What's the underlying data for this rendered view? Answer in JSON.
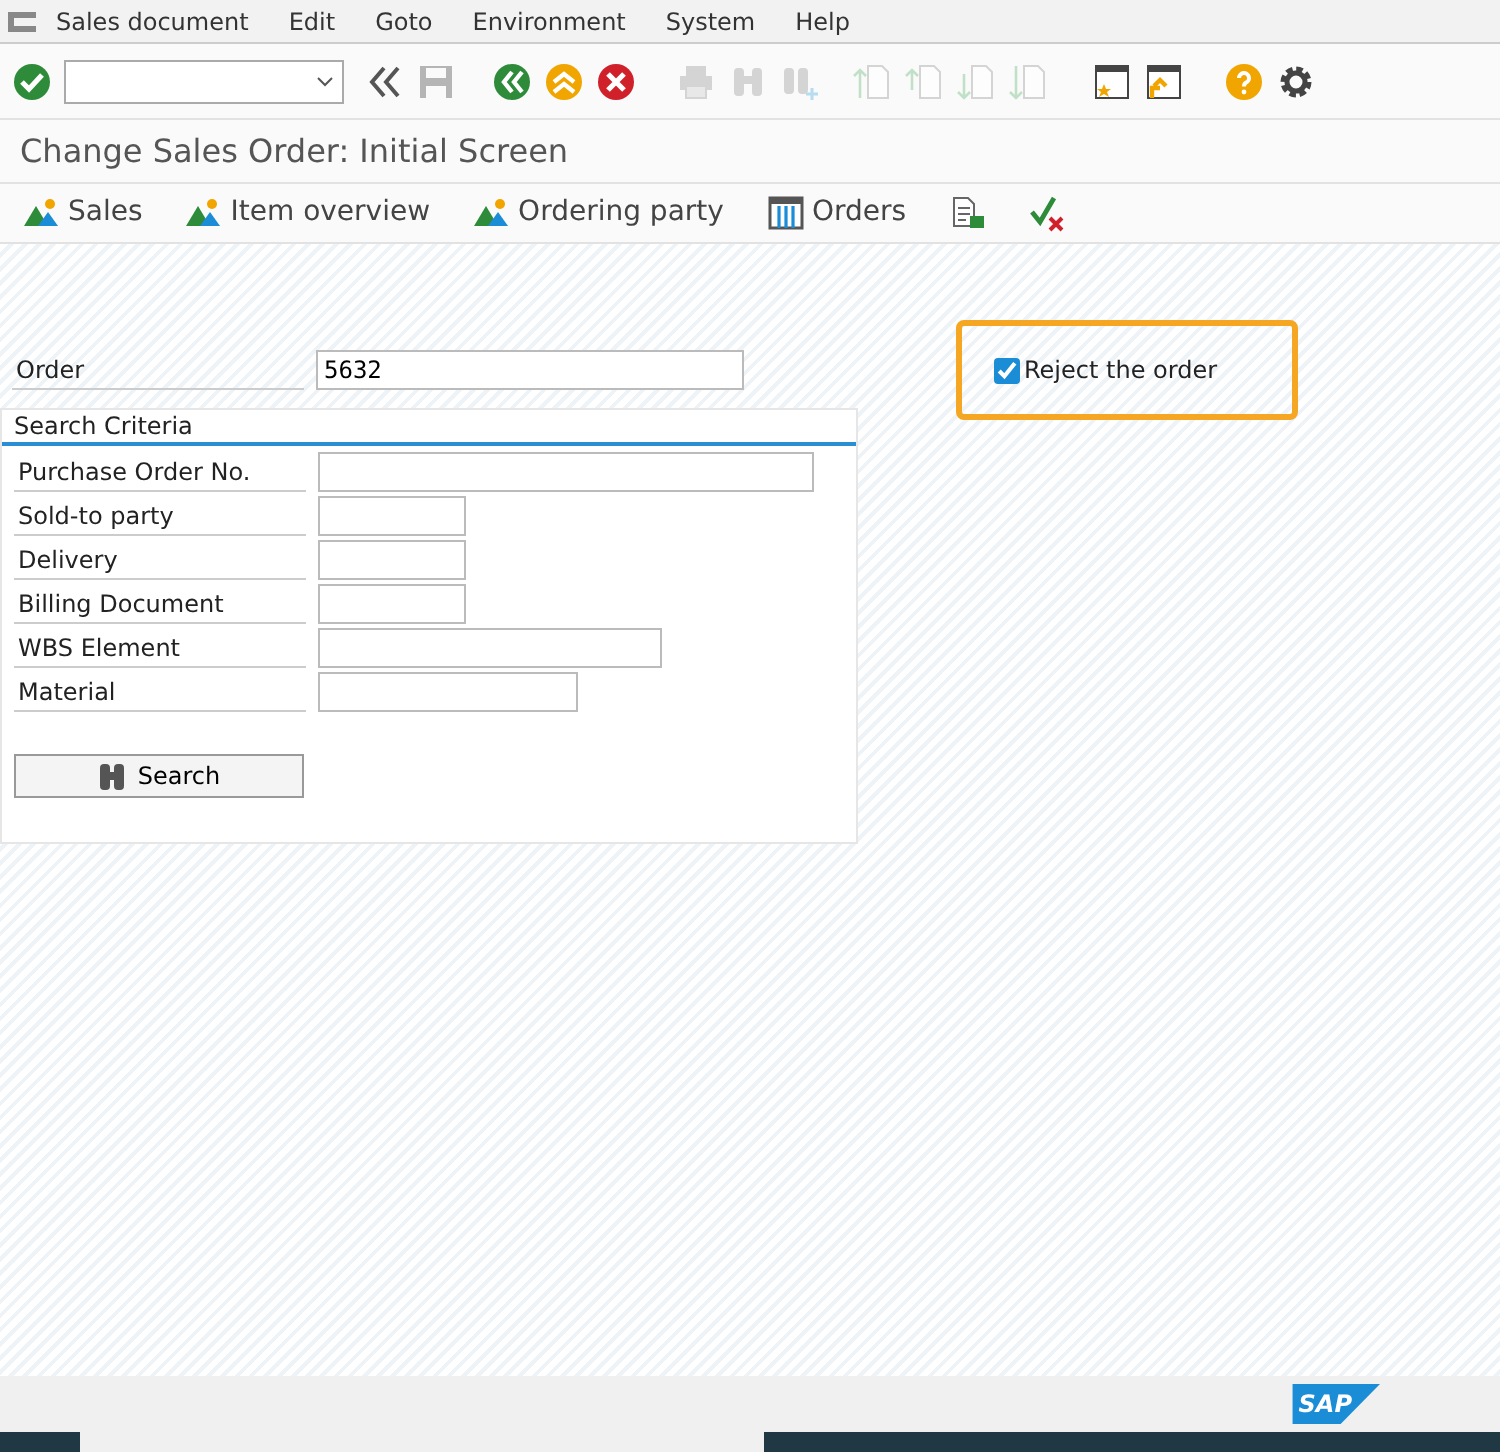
{
  "menu": [
    "Sales document",
    "Edit",
    "Goto",
    "Environment",
    "System",
    "Help"
  ],
  "toolbar": [
    {
      "kind": "enter",
      "disabled": false
    },
    {
      "kind": "command-field"
    },
    {
      "kind": "collapse",
      "disabled": false
    },
    {
      "kind": "save",
      "disabled": true
    },
    {
      "kind": "back",
      "disabled": false
    },
    {
      "kind": "exit",
      "disabled": false
    },
    {
      "kind": "cancel",
      "disabled": false
    },
    {
      "kind": "print",
      "disabled": true
    },
    {
      "kind": "find",
      "disabled": true
    },
    {
      "kind": "find-next",
      "disabled": true
    },
    {
      "kind": "first-page",
      "disabled": true
    },
    {
      "kind": "prev-page",
      "disabled": true
    },
    {
      "kind": "next-page",
      "disabled": true
    },
    {
      "kind": "last-page",
      "disabled": true
    },
    {
      "kind": "new-session",
      "disabled": false
    },
    {
      "kind": "shortcut",
      "disabled": false
    },
    {
      "kind": "help",
      "disabled": false
    },
    {
      "kind": "settings",
      "disabled": false
    }
  ],
  "title": "Change Sales Order: Initial Screen",
  "app_toolbar": [
    {
      "kind": "mountain",
      "label": "Sales"
    },
    {
      "kind": "mountain",
      "label": "Item overview"
    },
    {
      "kind": "mountain",
      "label": "Ordering party"
    },
    {
      "kind": "grid",
      "label": "Orders"
    },
    {
      "kind": "document"
    },
    {
      "kind": "check-cross"
    }
  ],
  "order": {
    "label": "Order",
    "value": "5632"
  },
  "reject": {
    "label": "Reject the order",
    "checked": true,
    "highlighted": true
  },
  "search_criteria": {
    "title": "Search Criteria",
    "fields": [
      {
        "label": "Purchase Order No."
      },
      {
        "label": "Sold-to party"
      },
      {
        "label": "Delivery"
      },
      {
        "label": "Billing Document"
      },
      {
        "label": "WBS Element"
      },
      {
        "label": "Material"
      }
    ],
    "button": "Search"
  },
  "footer": {
    "logo": "SAP"
  }
}
